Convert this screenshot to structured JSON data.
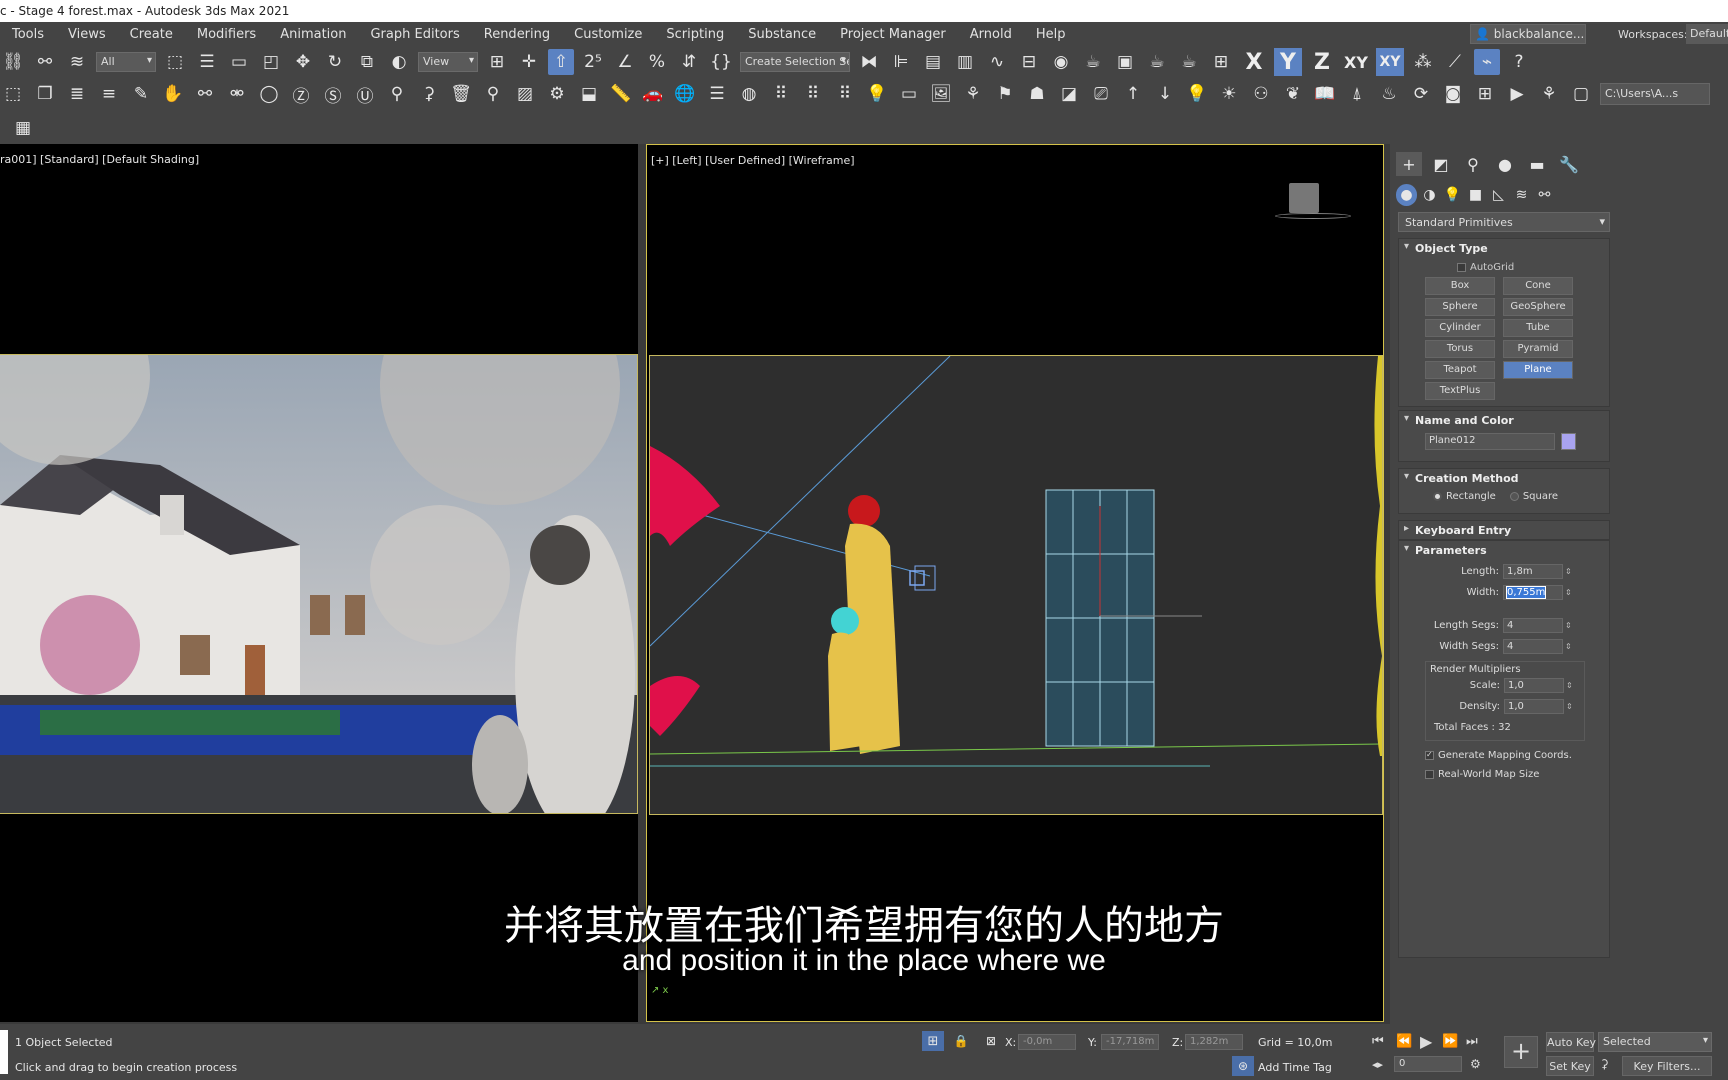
{
  "window": {
    "title": "c - Stage 4 forest.max - Autodesk 3ds Max 2021"
  },
  "menu": [
    "Tools",
    "Views",
    "Create",
    "Modifiers",
    "Animation",
    "Graph Editors",
    "Rendering",
    "Customize",
    "Scripting",
    "Substance",
    "Project Manager",
    "Arnold",
    "Help"
  ],
  "user": {
    "name": "blackbalance...",
    "workspaces_label": "Workspaces:",
    "workspace": "Default"
  },
  "toolbar": {
    "selection_filter": "All",
    "ref_coord": "View",
    "named_selection": "Create Selection Se",
    "axis_x": "X",
    "axis_y": "Y",
    "axis_z": "Z",
    "axis_xy": "XY",
    "axis_xy2": "XY",
    "project_path": "C:\\Users\\A...s"
  },
  "viewports": {
    "camera_label": "ra001] [Standard] [Default Shading]",
    "left_label": "[+] [Left] [User Defined] [Wireframe]"
  },
  "subtitle": {
    "zh": "并将其放置在我们希望拥有您的人的地方",
    "en": "and position it in the place where we"
  },
  "command_panel": {
    "category": "Standard Primitives",
    "object_type": {
      "title": "Object Type",
      "autogrid": "AutoGrid",
      "buttons": [
        "Box",
        "Cone",
        "Sphere",
        "GeoSphere",
        "Cylinder",
        "Tube",
        "Torus",
        "Pyramid",
        "Teapot",
        "Plane",
        "TextPlus"
      ],
      "active": "Plane"
    },
    "name_color": {
      "title": "Name and Color",
      "name": "Plane012",
      "color": "#a9a4f0"
    },
    "creation_method": {
      "title": "Creation Method",
      "options": [
        "Rectangle",
        "Square"
      ],
      "selected": "Rectangle"
    },
    "keyboard_entry": {
      "title": "Keyboard Entry"
    },
    "parameters": {
      "title": "Parameters",
      "length_label": "Length:",
      "length": "1,8m",
      "width_label": "Width:",
      "width": "0,755m",
      "length_segs_label": "Length Segs:",
      "length_segs": "4",
      "width_segs_label": "Width Segs:",
      "width_segs": "4",
      "render_multipliers": "Render Multipliers",
      "scale_label": "Scale:",
      "scale": "1,0",
      "density_label": "Density:",
      "density": "1,0",
      "total_faces": "Total Faces : 32",
      "generate_mapping": "Generate Mapping Coords.",
      "generate_mapping_checked": true,
      "real_world": "Real-World Map Size",
      "real_world_checked": false
    }
  },
  "status": {
    "selected": "1 Object Selected",
    "prompt": "Click and drag to begin creation process",
    "x_label": "X:",
    "x": "-0,0m",
    "y_label": "Y:",
    "y": "-17,718m",
    "z_label": "Z:",
    "z": "1,282m",
    "grid": "Grid = 10,0m",
    "add_time_tag": "Add Time Tag",
    "frame": "0",
    "auto_key": "Auto Key",
    "set_key": "Set Key",
    "key_mode": "Selected",
    "key_filters": "Key Filters..."
  }
}
